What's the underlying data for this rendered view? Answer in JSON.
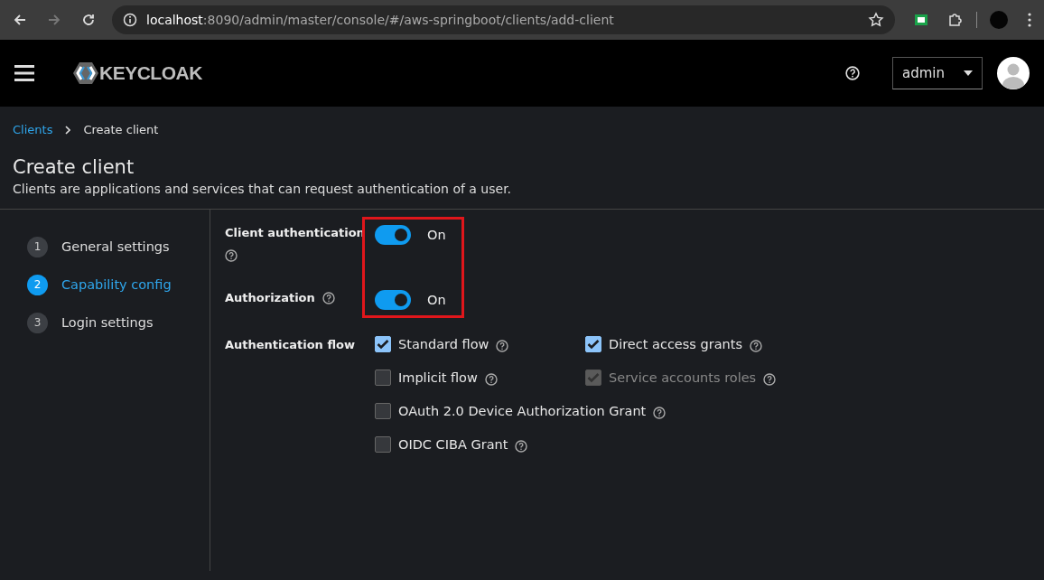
{
  "browser": {
    "url": "**localhost**:8090/admin/master/console/#/aws-springboot/clients/add-client"
  },
  "header": {
    "logo": "KEYCLOAK",
    "user": "admin"
  },
  "breadcrumb": [
    {
      "label": "Clients",
      "kind": "link"
    },
    {
      "label": "Create client",
      "kind": "current"
    }
  ],
  "page": {
    "title": "Create client",
    "description": "Clients are applications and services that can request authentication of a user."
  },
  "steps": [
    {
      "number": "1",
      "label": "General settings",
      "selected": false
    },
    {
      "number": "2",
      "label": "Capability config",
      "selected": true
    },
    {
      "number": "3",
      "label": "Login settings",
      "selected": false
    }
  ],
  "switches": [
    {
      "label": "Client authentication",
      "on": true,
      "state_text": "On"
    },
    {
      "label": "Authorization",
      "on": true,
      "state_text": "On"
    }
  ],
  "authentication_flow": {
    "label": "Authentication flow",
    "rows": [
      [
        {
          "label": "Standard flow",
          "checked": true,
          "disabled": false
        },
        {
          "label": "Direct access grants",
          "checked": true,
          "disabled": false
        }
      ],
      [
        {
          "label": "Implicit flow",
          "checked": false,
          "disabled": false
        },
        {
          "label": "Service accounts roles",
          "checked": true,
          "disabled": true
        }
      ],
      [
        {
          "label": "OAuth 2.0 Device Authorization Grant",
          "checked": false,
          "disabled": false
        }
      ],
      [
        {
          "label": "OIDC CIBA Grant",
          "checked": false,
          "disabled": false
        }
      ]
    ]
  }
}
